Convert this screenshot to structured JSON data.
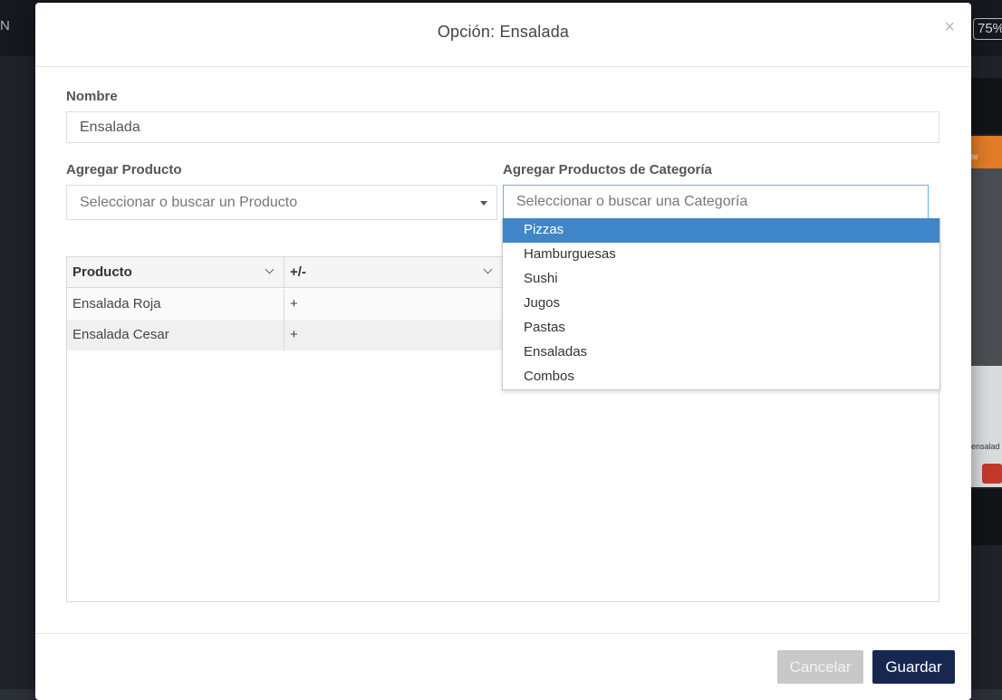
{
  "background": {
    "left_letter": "N",
    "zoom": "75%",
    "right_orange_text": "te",
    "right_card_text": "ensalad"
  },
  "modal": {
    "title": "Opción: Ensalada",
    "close_symbol": "×",
    "nombre_label": "Nombre",
    "nombre_value": "Ensalada",
    "agregar_producto_label": "Agregar Producto",
    "agregar_producto_placeholder": "Seleccionar o buscar un Producto",
    "agregar_categoria_label": "Agregar Productos de Categoría",
    "agregar_categoria_placeholder": "Seleccionar o buscar una Categoría"
  },
  "table": {
    "columns": [
      "Producto",
      "+/-"
    ],
    "rows": [
      {
        "producto": "Ensalada Roja",
        "sign": "+"
      },
      {
        "producto": "Ensalada Cesar",
        "sign": "+"
      }
    ]
  },
  "dropdown": {
    "options": [
      "Pizzas",
      "Hamburguesas",
      "Sushi",
      "Jugos",
      "Pastas",
      "Ensaladas",
      "Combos"
    ],
    "highlighted": "Pizzas",
    "highlight_color": "#3f87c8"
  },
  "footer": {
    "cancel_label": "Cancelar",
    "save_label": "Guardar",
    "save_color": "#17274f"
  }
}
